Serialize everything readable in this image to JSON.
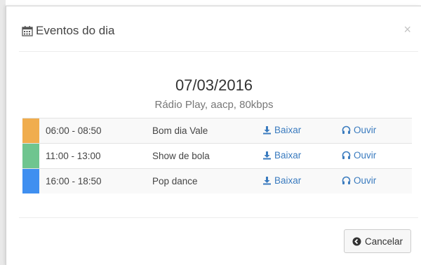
{
  "modal": {
    "title": "Eventos do dia",
    "calendar_icon": "calendar-icon",
    "close_label": "×",
    "date": "07/03/2016",
    "subtitle": "Rádio Play, aacp, 80kbps",
    "cancel_label": "Cancelar",
    "cancel_icon": "arrow-circle-left-icon"
  },
  "events": [
    {
      "time": "06:00 - 08:50",
      "program": "Bom dia Vale",
      "color": "#f0ad4e",
      "download_label": "Baixar",
      "listen_label": "Ouvir"
    },
    {
      "time": "11:00 - 13:00",
      "program": "Show de bola",
      "color": "#6fc58f",
      "download_label": "Baixar",
      "listen_label": "Ouvir"
    },
    {
      "time": "16:00 - 18:50",
      "program": "Pop dance",
      "color": "#3f8ff0",
      "download_label": "Baixar",
      "listen_label": "Ouvir"
    }
  ],
  "colors": {
    "link": "#3a7bbf"
  }
}
